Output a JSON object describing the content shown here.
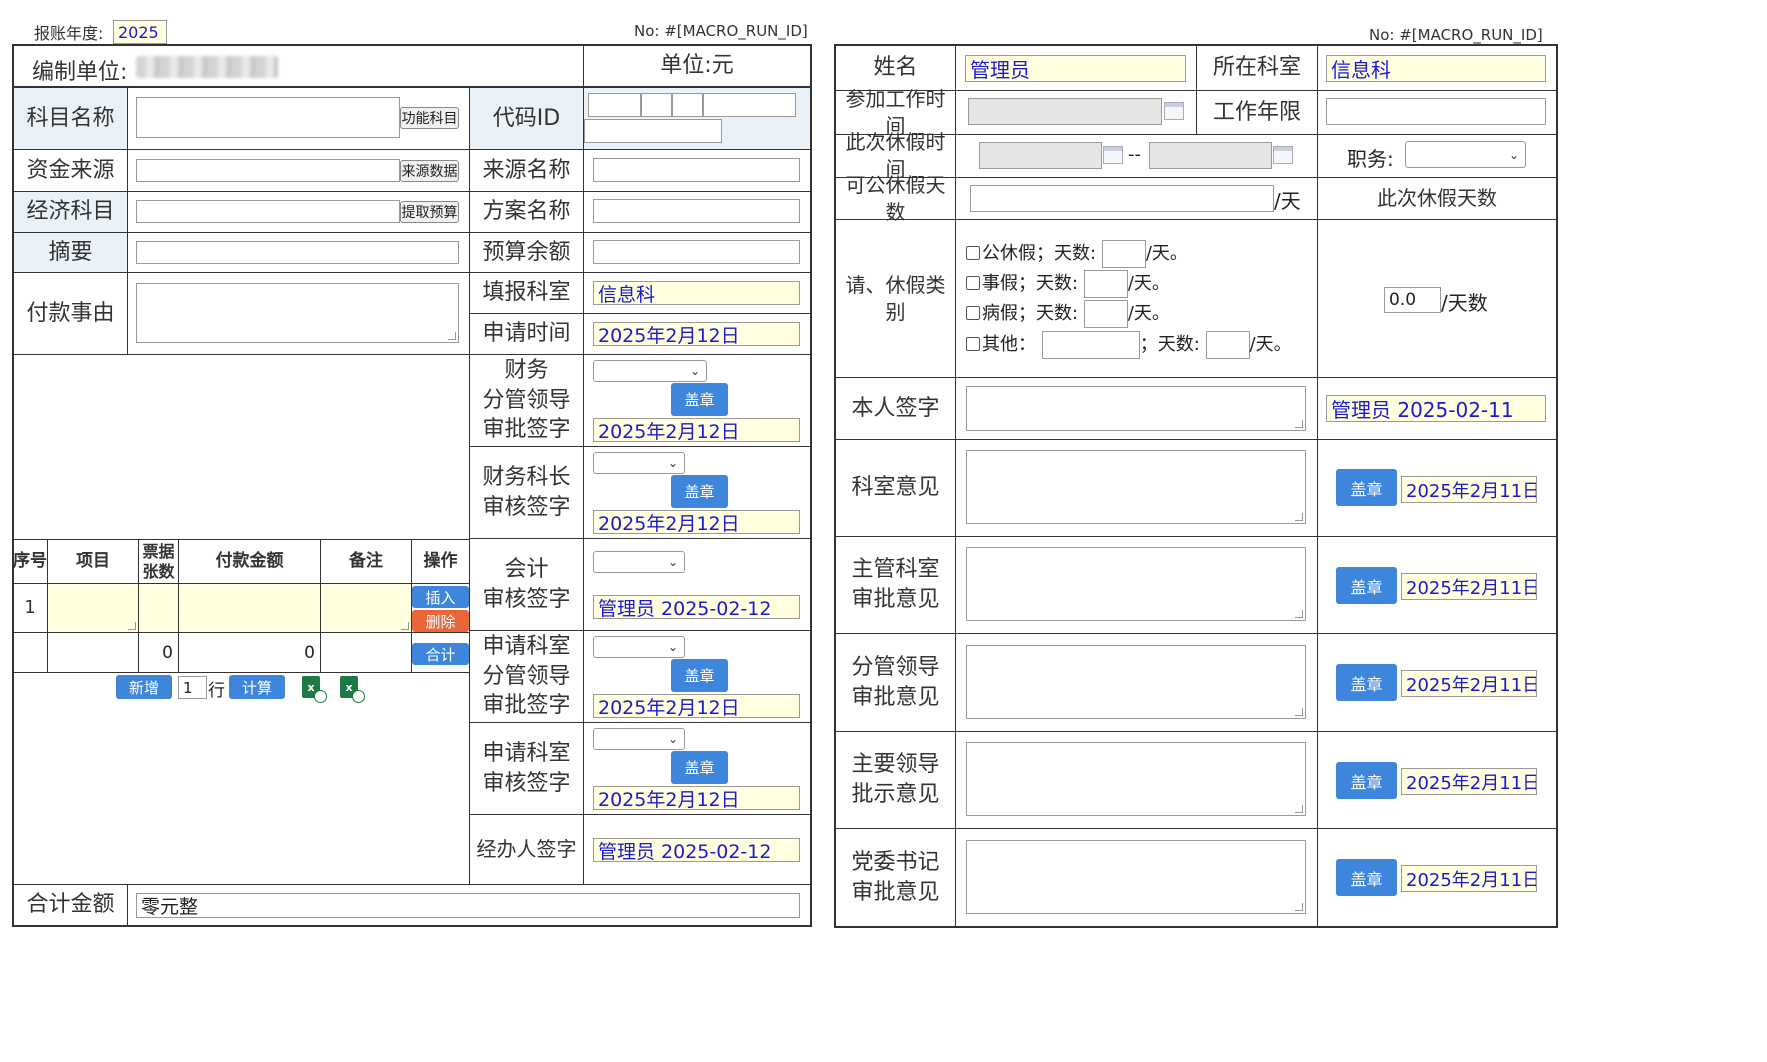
{
  "left": {
    "year_label": "报账年度:",
    "year_value": "2025",
    "no_label": "No: #[MACRO_RUN_ID]",
    "unit_label": "编制单位:",
    "currency_label": "单位:元",
    "subject_name_label": "科目名称",
    "function_subject_btn": "功能科目",
    "code_id_label": "代码ID",
    "fund_source_label": "资金来源",
    "source_data_btn": "来源数据",
    "source_name_label": "来源名称",
    "econ_subject_label": "经济科目",
    "get_budget_btn": "提取预算",
    "plan_name_label": "方案名称",
    "summary_label": "摘要",
    "budget_balance_label": "预算余额",
    "pay_reason_label": "付款事由",
    "fill_dept_label": "填报科室",
    "fill_dept_value": "信息科",
    "apply_time_label": "申请时间",
    "apply_time_value": "2025年2月12日",
    "fin_leader_label": "财务\n分管领导\n审批签字",
    "fin_leader_date": "2025年2月12日",
    "fin_chief_label": "财务科长\n审核签字",
    "fin_chief_date": "2025年2月12日",
    "accountant_label": "会计\n审核签字",
    "accountant_value": "管理员 2025-02-12",
    "apply_dept_leader_label": "申请科室\n分管领导\n审批签字",
    "apply_dept_leader_date": "2025年2月12日",
    "apply_dept_review_label": "申请科室\n审核签字",
    "apply_dept_review_date": "2025年2月12日",
    "handler_label": "经办人签字",
    "handler_value": "管理员 2025-02-12",
    "stamp_btn": "盖章",
    "total_label": "合计金额",
    "total_value": "零元整",
    "table": {
      "headers": [
        "序号",
        "项目",
        "票据\n张数",
        "付款金额",
        "备注",
        "操作"
      ],
      "row_no": "1",
      "insert_btn": "插入",
      "delete_btn": "删除",
      "sum_btn": "合计",
      "sum_count": "0",
      "sum_amount": "0",
      "add_btn": "新增",
      "rows_value": "1",
      "rows_unit": "行",
      "calc_btn": "计算"
    }
  },
  "right": {
    "no_label": "No: #[MACRO_RUN_ID]",
    "name_label": "姓名",
    "name_value": "管理员",
    "dept_label": "所在科室",
    "dept_value": "信息科",
    "join_time_label": "参加工作时间",
    "work_years_label": "工作年限",
    "leave_time_label": "此次休假时间",
    "leave_sep": "--",
    "position_label": "职务:",
    "avail_days_label": "可公休假天数",
    "avail_days_unit": "/天",
    "this_days_label": "此次休假天数",
    "leave_type_label": "请、休假类别",
    "lt_public": "公休假；天数:",
    "lt_personal": "事假；天数:",
    "lt_sick": "病假；天数:",
    "lt_other": "其他：",
    "lt_other_days": "；天数:",
    "lt_unit": "/天。",
    "days_value": "0.0",
    "days_unit": "/天数",
    "self_sign_label": "本人签字",
    "self_sign_value": "管理员 2025-02-11",
    "dept_opinion_label": "科室意见",
    "main_dept_label": "主管科室\n审批意见",
    "sub_leader_label": "分管领导\n审批意见",
    "main_leader_label": "主要领导\n批示意见",
    "party_sec_label": "党委书记\n审批意见",
    "stamp_btn": "盖章",
    "opinion_date": "2025年2月11日"
  }
}
